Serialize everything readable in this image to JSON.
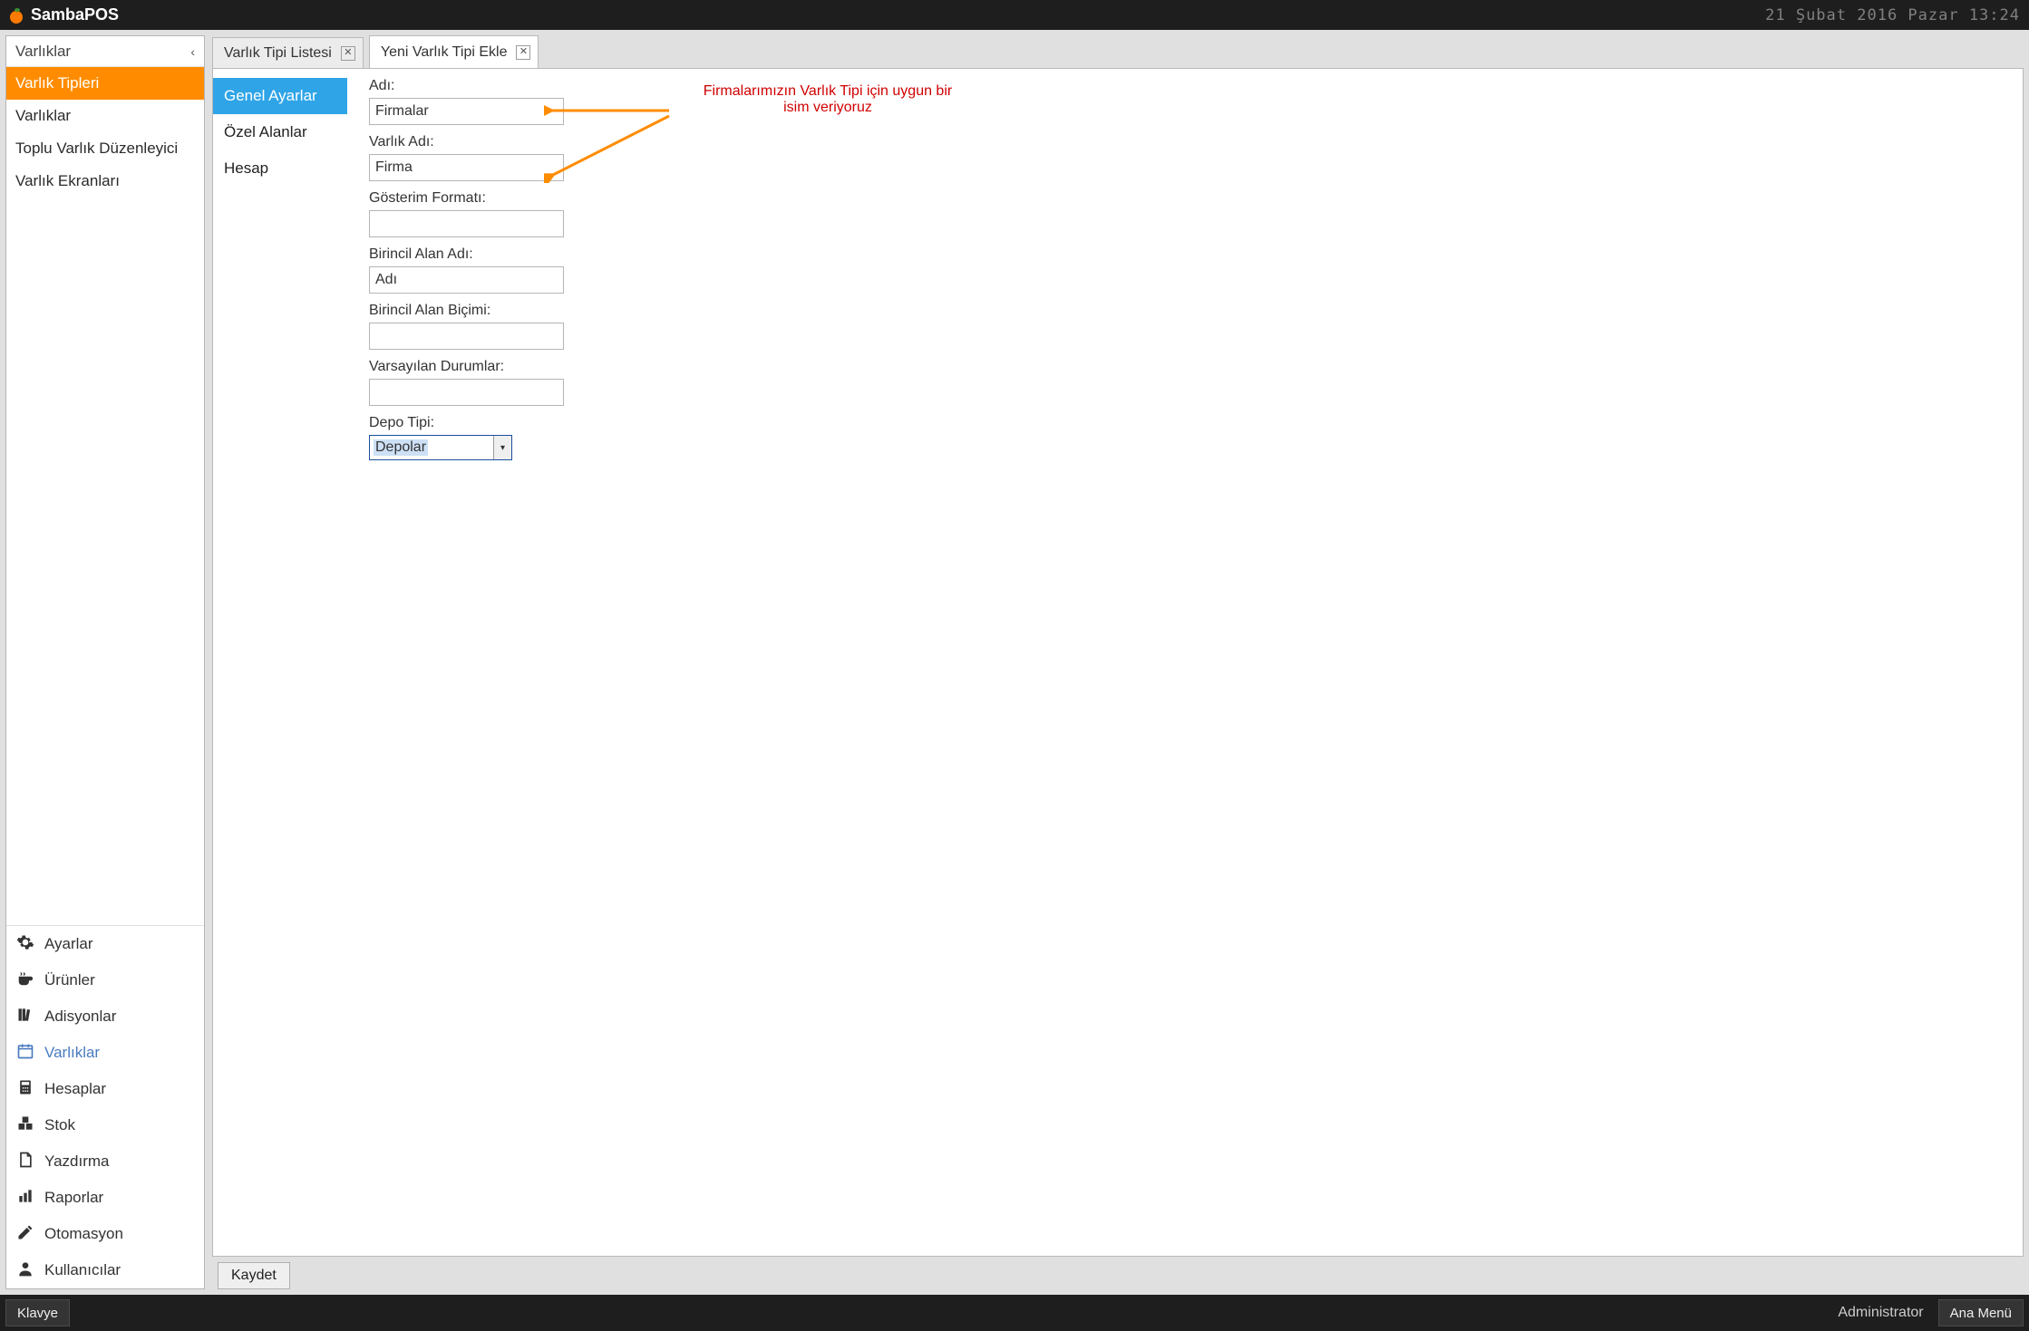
{
  "brand": {
    "name": "SambaPOS"
  },
  "datetime": "21 Şubat 2016 Pazar 13:24",
  "sidebar": {
    "header": "Varlıklar",
    "top_items": [
      {
        "label": "Varlık Tipleri",
        "active": true
      },
      {
        "label": "Varlıklar",
        "active": false
      },
      {
        "label": "Toplu Varlık Düzenleyici",
        "active": false
      },
      {
        "label": "Varlık Ekranları",
        "active": false
      }
    ],
    "bottom_items": [
      {
        "label": "Ayarlar",
        "icon": "gear"
      },
      {
        "label": "Ürünler",
        "icon": "cup"
      },
      {
        "label": "Adisyonlar",
        "icon": "books"
      },
      {
        "label": "Varlıklar",
        "icon": "calendar",
        "current": true
      },
      {
        "label": "Hesaplar",
        "icon": "calculator"
      },
      {
        "label": "Stok",
        "icon": "stock"
      },
      {
        "label": "Yazdırma",
        "icon": "document"
      },
      {
        "label": "Raporlar",
        "icon": "bars"
      },
      {
        "label": "Otomasyon",
        "icon": "pencil"
      },
      {
        "label": "Kullanıcılar",
        "icon": "user"
      }
    ]
  },
  "tabs": [
    {
      "label": "Varlık Tipi Listesi",
      "active": false
    },
    {
      "label": "Yeni Varlık Tipi Ekle",
      "active": true
    }
  ],
  "subtabs": [
    {
      "label": "Genel Ayarlar",
      "active": true
    },
    {
      "label": "Özel Alanlar",
      "active": false
    },
    {
      "label": "Hesap",
      "active": false
    }
  ],
  "form": {
    "adi_label": "Adı:",
    "adi_value": "Firmalar",
    "varlik_adi_label": "Varlık Adı:",
    "varlik_adi_value": "Firma",
    "gosterim_label": "Gösterim Formatı:",
    "gosterim_value": "",
    "birincil_adi_label": "Birincil Alan Adı:",
    "birincil_adi_value": "Adı",
    "birincil_bicimi_label": "Birincil Alan Biçimi:",
    "birincil_bicimi_value": "",
    "varsayilan_label": "Varsayılan Durumlar:",
    "varsayilan_value": "",
    "depo_label": "Depo Tipi:",
    "depo_value": "Depolar"
  },
  "annotation": {
    "line1": "Firmalarımızın Varlık Tipi için uygun bir",
    "line2": "isim veriyoruz"
  },
  "save_label": "Kaydet",
  "footer": {
    "klavye": "Klavye",
    "user": "Administrator",
    "ana_menu": "Ana Menü"
  }
}
